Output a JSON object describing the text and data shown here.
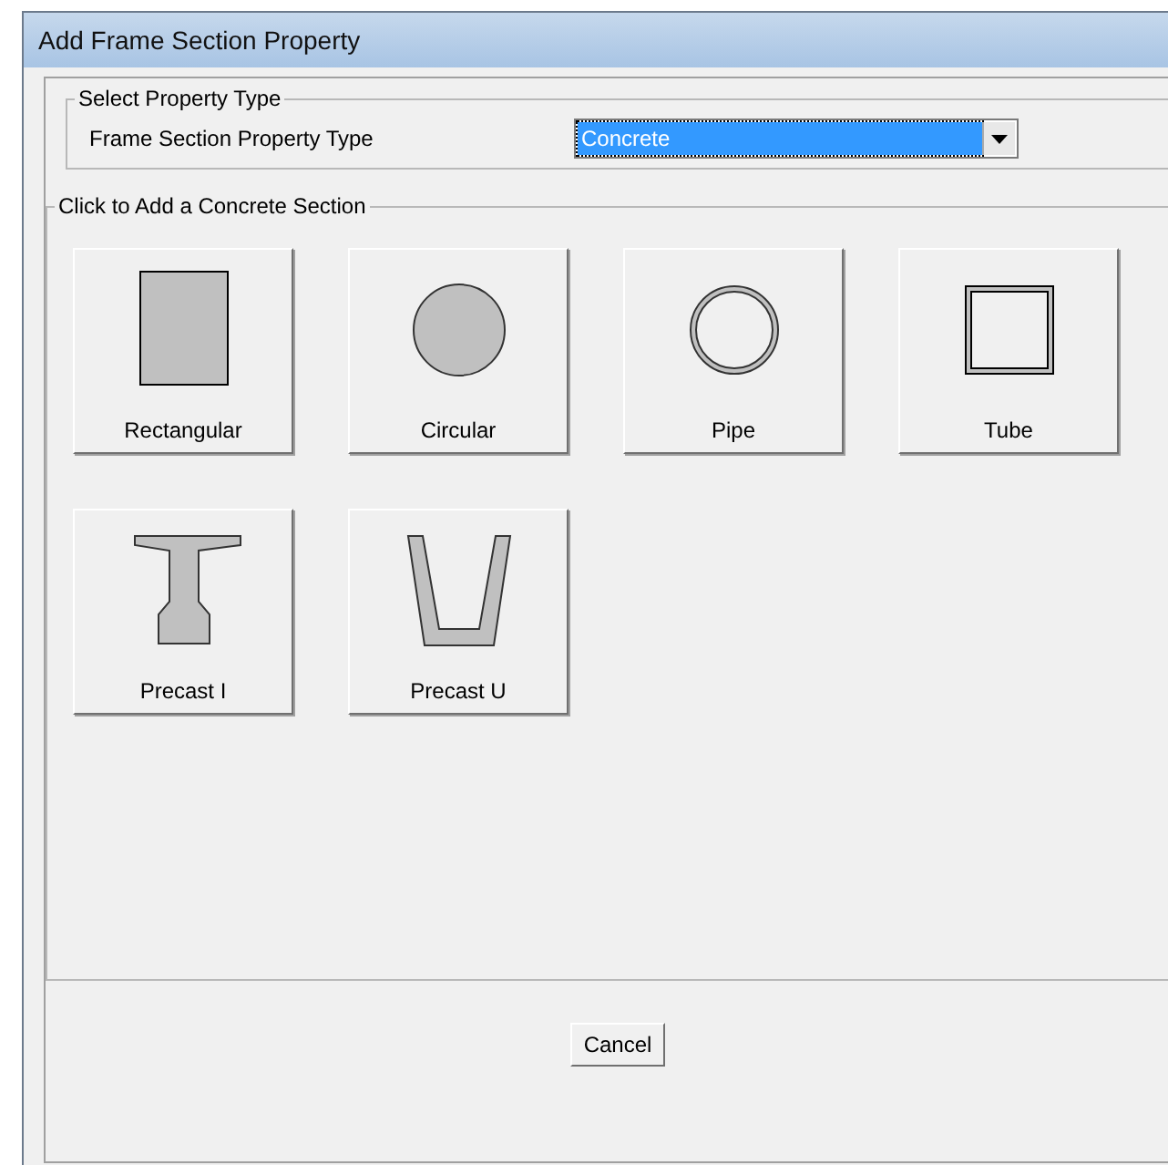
{
  "window": {
    "title": "Add Frame Section Property"
  },
  "property_type_group": {
    "title": "Select Property Type",
    "label": "Frame Section Property Type",
    "value": "Concrete"
  },
  "sections_group": {
    "title": "Click to Add a Concrete Section",
    "sections": [
      {
        "label": "Rectangular",
        "kind": "rect"
      },
      {
        "label": "Circular",
        "kind": "circle"
      },
      {
        "label": "Pipe",
        "kind": "pipe"
      },
      {
        "label": "Tube",
        "kind": "tube"
      },
      {
        "label": "Precast I",
        "kind": "precast-i"
      },
      {
        "label": "Precast U",
        "kind": "precast-u"
      }
    ]
  },
  "buttons": [
    "Cancel"
  ]
}
